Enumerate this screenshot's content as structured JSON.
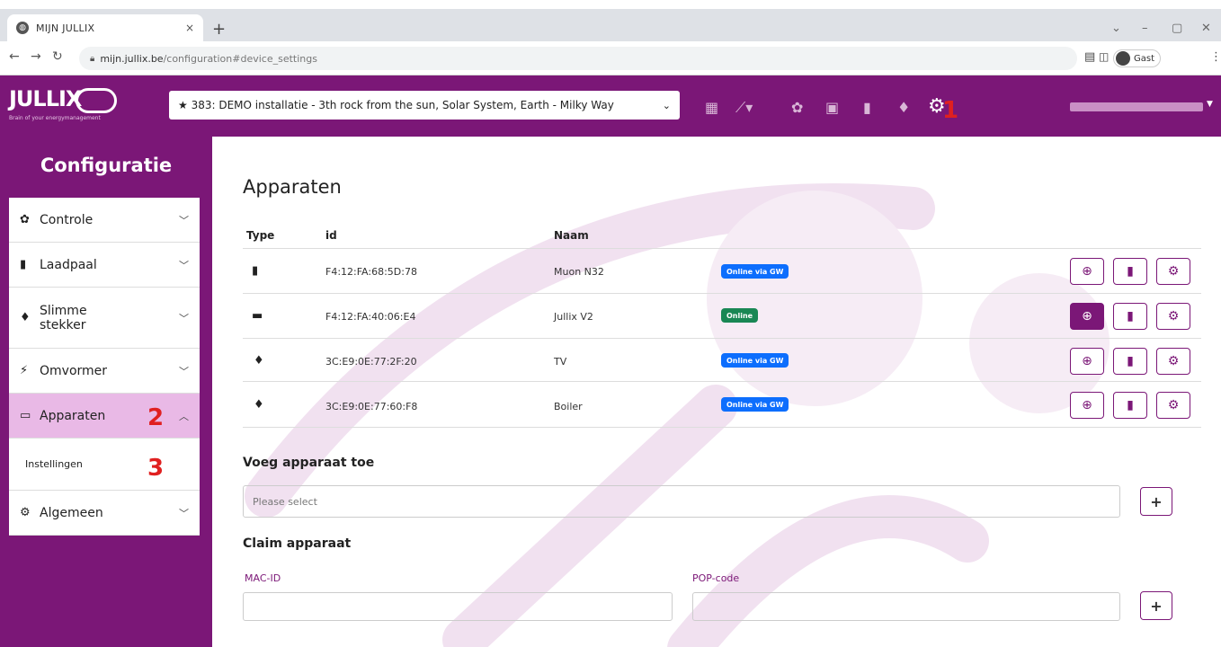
{
  "browser": {
    "tab_title": "MIJN JULLIX",
    "tab_close": "×",
    "new_tab": "+",
    "url_domain": "mijn.jullix.be",
    "url_path": "/configuration#device_settings",
    "guest_label": "Gast"
  },
  "header": {
    "logo_text": "JULLIX",
    "logo_tagline": "Brain of your energymanagement",
    "installation": "★ 383: DEMO installatie - 3th rock from the sun, Solar System, Earth - Milky Way"
  },
  "annotations": {
    "one": "1",
    "two": "2",
    "three": "3"
  },
  "sidebar": {
    "title": "Configuratie",
    "items": [
      {
        "label": "Controle"
      },
      {
        "label": "Laadpaal"
      },
      {
        "label": "Slimme stekker"
      },
      {
        "label": "Omvormer"
      },
      {
        "label": "Apparaten"
      },
      {
        "label": "Instellingen"
      },
      {
        "label": "Algemeen"
      }
    ]
  },
  "main": {
    "title": "Apparaten",
    "columns": {
      "type": "Type",
      "id": "id",
      "naam": "Naam"
    },
    "rows": [
      {
        "id": "F4:12:FA:68:5D:78",
        "naam": "Muon N32",
        "status": "Online via GW",
        "icon": "charger-icon"
      },
      {
        "id": "F4:12:FA:40:06:E4",
        "naam": "Jullix V2",
        "status": "Online",
        "icon": "gateway-icon"
      },
      {
        "id": "3C:E9:0E:77:2F:20",
        "naam": "TV",
        "status": "Online via GW",
        "icon": "plug-icon"
      },
      {
        "id": "3C:E9:0E:77:60:F8",
        "naam": "Boiler",
        "status": "Online via GW",
        "icon": "plug-icon"
      }
    ],
    "add_title": "Voeg apparaat toe",
    "add_placeholder": "Please select",
    "claim_title": "Claim apparaat",
    "mac_label": "MAC-ID",
    "pop_label": "POP-code",
    "plus": "+"
  },
  "colors": {
    "brand": "#7b1777",
    "badge_blue": "#0d6efd",
    "badge_green": "#198754",
    "active_menu": "#e9b9e6"
  }
}
